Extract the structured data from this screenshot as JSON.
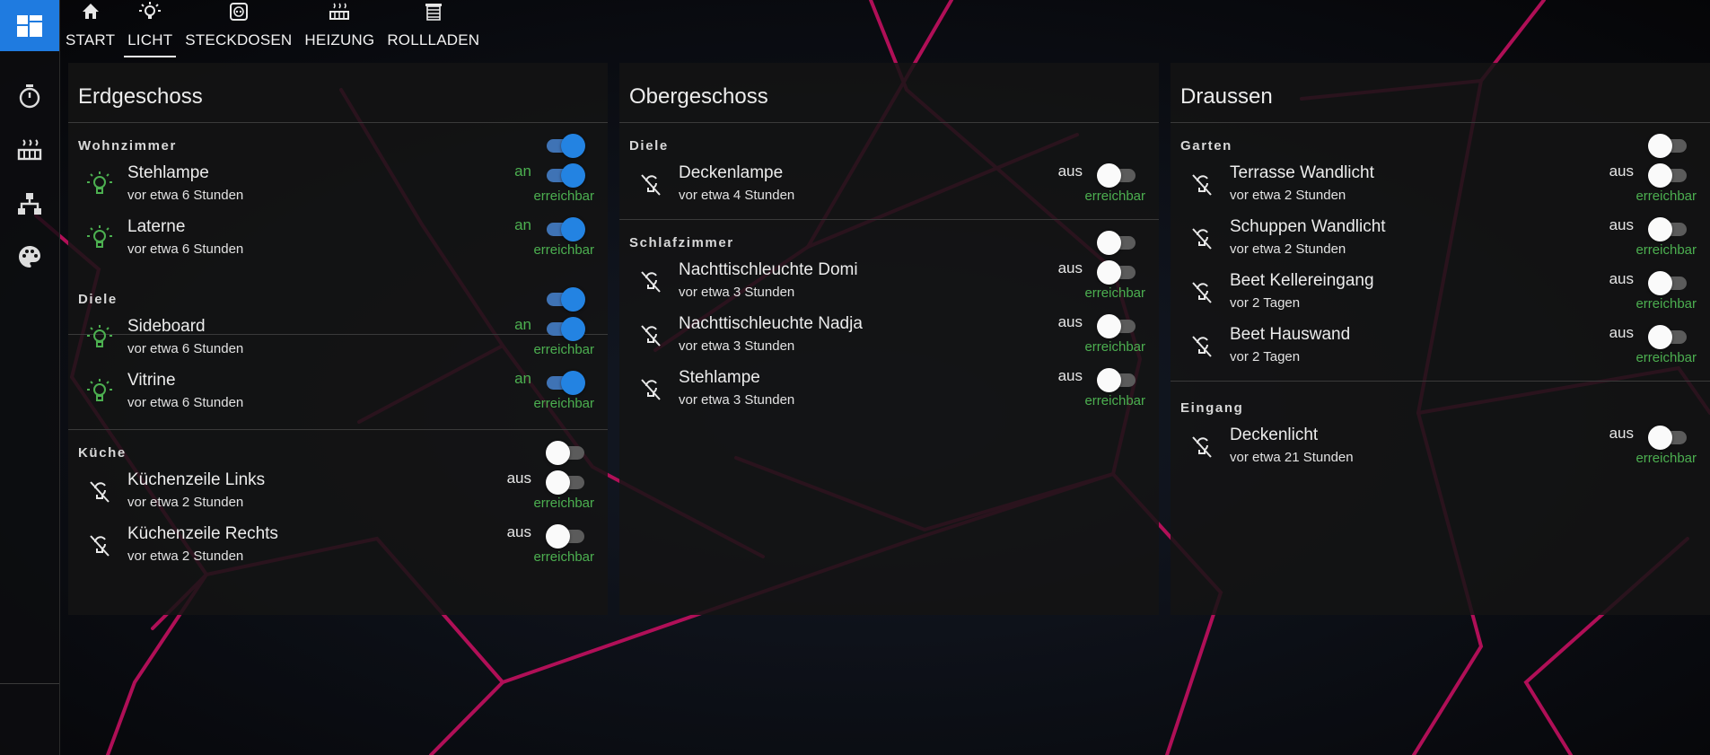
{
  "colors": {
    "accent": "#2383e2",
    "state_on": "#4caf50",
    "background": "#0c0c10",
    "panel": "#141414",
    "background_line": "#c2105f"
  },
  "sidebar": {
    "logo_icon": "dashboard-icon",
    "items": [
      {
        "icon": "timer-icon"
      },
      {
        "icon": "radiator-icon"
      },
      {
        "icon": "network-icon"
      },
      {
        "icon": "palette-icon"
      }
    ]
  },
  "tabs": [
    {
      "label": "START",
      "icon": "home-icon"
    },
    {
      "label": "LICHT",
      "icon": "lightbulb-icon",
      "active": true
    },
    {
      "label": "STECKDOSEN",
      "icon": "power-socket-icon"
    },
    {
      "label": "HEIZUNG",
      "icon": "radiator-icon"
    },
    {
      "label": "ROLLLADEN",
      "icon": "window-shutter-icon"
    }
  ],
  "panels": [
    {
      "title": "Erdgeschoss",
      "groups": [
        {
          "label": "Wohnzimmer",
          "on": true,
          "entities": [
            {
              "name": "Stehlampe",
              "time": "vor etwa 6 Stunden",
              "state": "an",
              "on": true,
              "reach": "erreichbar"
            },
            {
              "name": "Laterne",
              "time": "vor etwa 6 Stunden",
              "state": "an",
              "on": true,
              "reach": "erreichbar"
            }
          ]
        },
        {
          "label": "Diele",
          "on": true,
          "entities": [
            {
              "name": "Sideboard",
              "time": "vor etwa 6 Stunden",
              "state": "an",
              "on": true,
              "reach": "erreichbar"
            },
            {
              "name": "Vitrine",
              "time": "vor etwa 6 Stunden",
              "state": "an",
              "on": true,
              "reach": "erreichbar"
            }
          ]
        },
        {
          "label": "Küche",
          "on": false,
          "entities": [
            {
              "name": "Küchenzeile Links",
              "time": "vor etwa 2 Stunden",
              "state": "aus",
              "on": false,
              "reach": "erreichbar"
            },
            {
              "name": "Küchenzeile Rechts",
              "time": "vor etwa 2 Stunden",
              "state": "aus",
              "on": false,
              "reach": "erreichbar"
            }
          ]
        }
      ]
    },
    {
      "title": "Obergeschoss",
      "groups": [
        {
          "label": "Diele",
          "on": null,
          "entities": [
            {
              "name": "Deckenlampe",
              "time": "vor etwa 4 Stunden",
              "state": "aus",
              "on": false,
              "reach": "erreichbar"
            }
          ]
        },
        {
          "label": "Schlafzimmer",
          "on": false,
          "entities": [
            {
              "name": "Nachttischleuchte Domi",
              "time": "vor etwa 3 Stunden",
              "state": "aus",
              "on": false,
              "reach": "erreichbar"
            },
            {
              "name": "Nachttischleuchte Nadja",
              "time": "vor etwa 3 Stunden",
              "state": "aus",
              "on": false,
              "reach": "erreichbar"
            },
            {
              "name": "Stehlampe",
              "time": "vor etwa 3 Stunden",
              "state": "aus",
              "on": false,
              "reach": "erreichbar"
            }
          ]
        }
      ]
    },
    {
      "title": "Draussen",
      "groups": [
        {
          "label": "Garten",
          "on": false,
          "entities": [
            {
              "name": "Terrasse Wandlicht",
              "time": "vor etwa 2 Stunden",
              "state": "aus",
              "on": false,
              "reach": "erreichbar"
            },
            {
              "name": "Schuppen Wandlicht",
              "time": "vor etwa 2 Stunden",
              "state": "aus",
              "on": false,
              "reach": "erreichbar"
            },
            {
              "name": "Beet Kellereingang",
              "time": "vor 2 Tagen",
              "state": "aus",
              "on": false,
              "reach": "erreichbar"
            },
            {
              "name": "Beet Hauswand",
              "time": "vor 2 Tagen",
              "state": "aus",
              "on": false,
              "reach": "erreichbar"
            }
          ]
        },
        {
          "label": "Eingang",
          "on": null,
          "entities": [
            {
              "name": "Deckenlicht",
              "time": "vor etwa 21 Stunden",
              "state": "aus",
              "on": false,
              "reach": "erreichbar"
            }
          ]
        }
      ]
    }
  ]
}
